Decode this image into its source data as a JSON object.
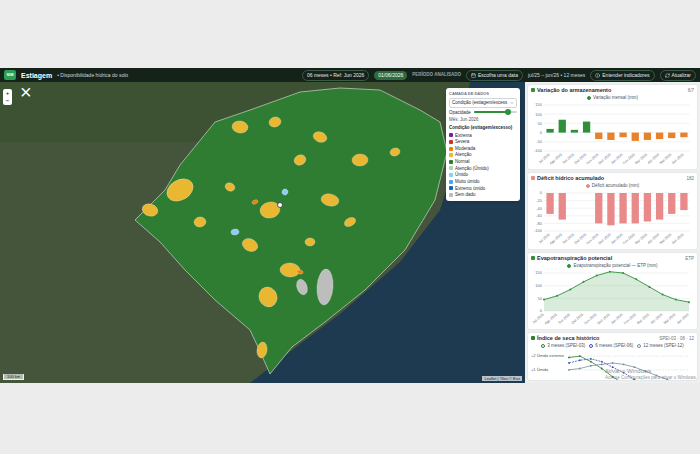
{
  "header": {
    "logo": "SIM",
    "title": "Estiagem",
    "subtitle": "• Disponibilidade hídrica do solo",
    "window_badge": "06 meses • Ref: Jun 2026",
    "date_badge": "01/06/2026",
    "period_label": "PERÍODO ANALISADO",
    "date_button": "Escolha uma data",
    "period": "jul/25 – jun/26 • 12 meses",
    "help_button": "Entender indicadores",
    "refresh_button": "Atualizar"
  },
  "map": {
    "zoom_in": "+",
    "zoom_out": "−",
    "close": "×",
    "scale": "100 km",
    "attribution": "Leaflet | Tiles © Esri"
  },
  "legend": {
    "title": "CAMADA DE DADOS",
    "layer_select": "Condição (estiagem/excess",
    "opacity_label": "Opacidade",
    "opacity_level": 0.8,
    "month": "Mês: Jun 2026",
    "items_title": "Condição (estiagem/excesso)",
    "items": [
      {
        "label": "Extrema",
        "color": "#7b1fa2"
      },
      {
        "label": "Severa",
        "color": "#d32f2f"
      },
      {
        "label": "Moderada",
        "color": "#f57c00"
      },
      {
        "label": "Atenção",
        "color": "#e9b731"
      },
      {
        "label": "Normal",
        "color": "#2f7d32"
      },
      {
        "label": "Atenção (Úmido)",
        "color": "#a5d6a7"
      },
      {
        "label": "Úmido",
        "color": "#90caf9"
      },
      {
        "label": "Muito úmido",
        "color": "#42a5f5"
      },
      {
        "label": "Extremo úmido",
        "color": "#1565c0"
      },
      {
        "label": "Sem dado",
        "color": "#bdbdbd"
      }
    ]
  },
  "cards": [
    {
      "kind": "bar",
      "title": "Variação do armazenamento",
      "badge": "6/7",
      "ticks": [
        "150",
        "100",
        "50",
        "0",
        "-50",
        "-100"
      ],
      "labels": [
        "Jul 2025",
        "Ago 2025",
        "Set 2025",
        "Out 2025",
        "Nov 2025",
        "Dez 2025",
        "Jan 2026",
        "Fev 2026",
        "Mar 2026",
        "Abr 2026",
        "Mai 2026",
        "Jun 2026"
      ],
      "series": [
        {
          "label": "Variação mensal (mm)",
          "color": "#2f8f3a",
          "negative_color": "#e8822a",
          "values": [
            20,
            70,
            15,
            60,
            -35,
            -40,
            -25,
            -45,
            -40,
            -35,
            -30,
            -25
          ]
        }
      ]
    },
    {
      "kind": "bar",
      "title": "Déficit hídrico acumulado",
      "badge": "182",
      "ticks": [
        "0",
        "-20",
        "-40",
        "-60",
        "-80",
        "-100"
      ],
      "labels": [
        "Jul 2025",
        "Ago 2025",
        "Set 2025",
        "Out 2025",
        "Nov 2025",
        "Dez 2025",
        "Jan 2026",
        "Fev 2026",
        "Mar 2026",
        "Abr 2026",
        "Mai 2026",
        "Jun 2026"
      ],
      "series": [
        {
          "label": "Déficit acumulado (mm)",
          "color": "#e88a8a",
          "values": [
            -55,
            -70,
            0,
            0,
            -80,
            -85,
            -80,
            -80,
            -75,
            -70,
            -55,
            -45
          ]
        }
      ]
    },
    {
      "kind": "area",
      "title": "Evapotranspiração potencial",
      "badge": "ETP",
      "ticks": [
        "150",
        "100",
        "50",
        "0"
      ],
      "labels": [
        "Jul 2025",
        "Ago 2025",
        "Set 2025",
        "Out 2025",
        "Nov 2025",
        "Dez 2025",
        "Jan 2026",
        "Fev 2026",
        "Mar 2026",
        "Abr 2026",
        "Mai 2026",
        "Jun 2026"
      ],
      "series": [
        {
          "label": "Evapotranspiração potencial — ETP (mm)",
          "color": "#2f8f3a",
          "values": [
            45,
            60,
            85,
            115,
            140,
            155,
            150,
            125,
            95,
            65,
            45,
            35
          ]
        }
      ]
    },
    {
      "kind": "lines",
      "title": "Índice de seca histórico",
      "badge": "SPEI-03 · 06 · 12",
      "ticks": [
        "+2 Úmido extremo",
        "+1 Úmido"
      ],
      "labels": [],
      "series": [
        {
          "label": "3 meses (SPEI-03)",
          "color": "#2e7d32",
          "values": [
            1.9,
            2.0,
            1.6,
            1.1,
            0.5,
            0.0,
            -0.5,
            -0.9,
            -1.2,
            -1.0,
            -0.8,
            -0.6
          ]
        },
        {
          "label": "6 meses (SPEI-06)",
          "color": "#3f51b5",
          "values": [
            1.5,
            1.7,
            1.8,
            1.6,
            1.2,
            0.8,
            0.3,
            -0.2,
            -0.6,
            -0.9,
            -1.0,
            -0.9
          ]
        },
        {
          "label": "12 meses (SPEI-12)",
          "color": "#78909c",
          "values": [
            1.0,
            1.1,
            1.3,
            1.4,
            1.5,
            1.4,
            1.2,
            0.9,
            0.6,
            0.3,
            0.0,
            -0.2
          ]
        }
      ]
    }
  ],
  "watermark": {
    "title": "Ativar o Windows",
    "text": "Acesse Configurações para ativar o Windows."
  }
}
